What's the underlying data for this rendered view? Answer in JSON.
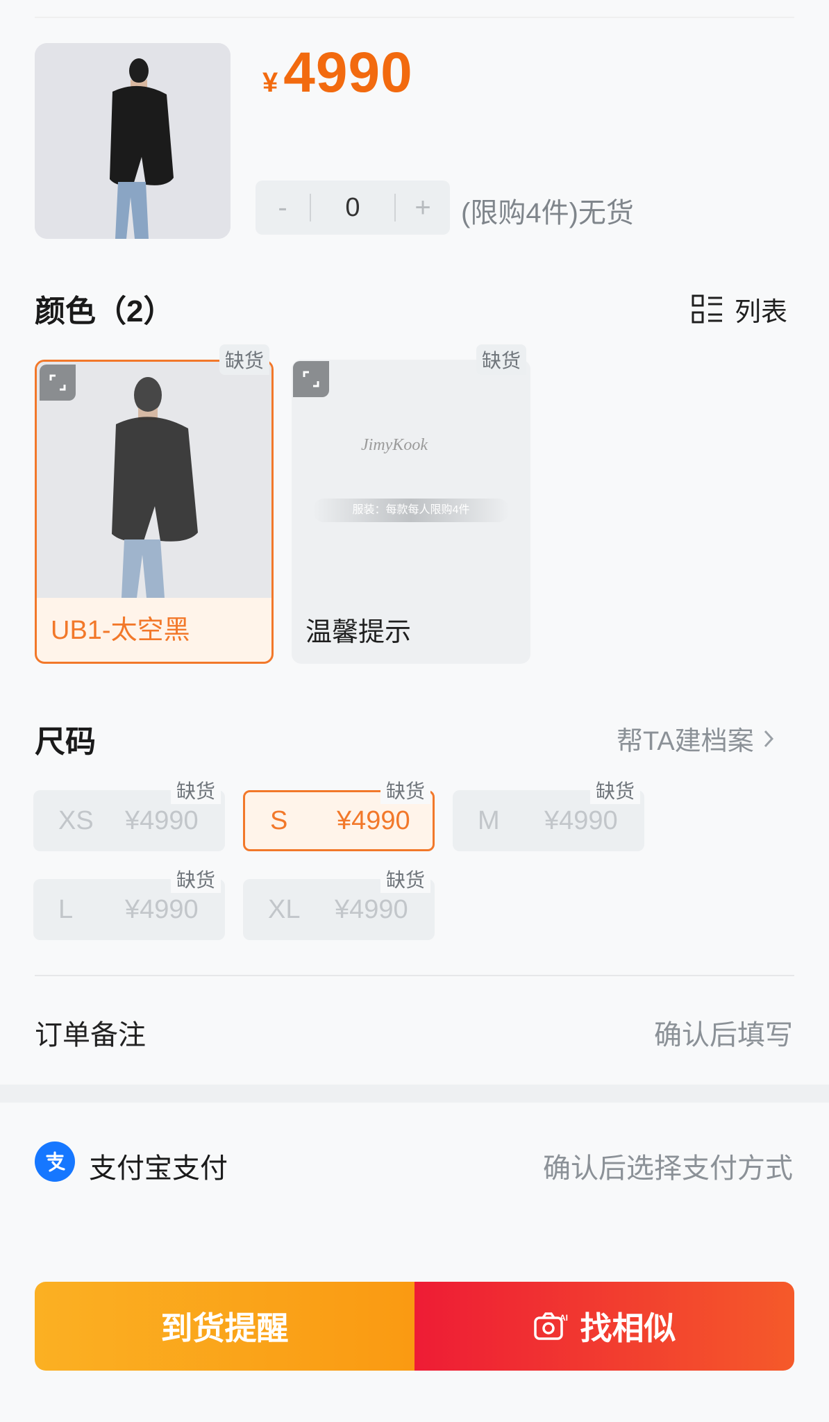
{
  "product": {
    "price_currency": "¥",
    "price_value": "4990",
    "quantity": "0",
    "minus_label": "-",
    "plus_label": "+",
    "limit_text": "(限购4件)无货"
  },
  "color_section": {
    "title": "颜色（2）",
    "list_label": "列表",
    "options": [
      {
        "label": "UB1-太空黑",
        "stock": "缺货"
      },
      {
        "label": "温馨提示",
        "stock": "缺货",
        "notice_brand": "JimyKook",
        "notice_text": "服装：每款每人限购4件"
      }
    ]
  },
  "size_section": {
    "title": "尺码",
    "archive_link": "帮TA建档案",
    "sizes": [
      {
        "size": "XS",
        "price": "¥4990",
        "stock": "缺货"
      },
      {
        "size": "S",
        "price": "¥4990",
        "stock": "缺货"
      },
      {
        "size": "M",
        "price": "¥4990",
        "stock": "缺货"
      },
      {
        "size": "L",
        "price": "¥4990",
        "stock": "缺货"
      },
      {
        "size": "XL",
        "price": "¥4990",
        "stock": "缺货"
      }
    ]
  },
  "remark": {
    "label": "订单备注",
    "value": "确认后填写"
  },
  "payment": {
    "label": "支付宝支付",
    "hint": "确认后选择支付方式"
  },
  "actions": {
    "notify_label": "到货提醒",
    "similar_label": "找相似"
  },
  "colors": {
    "accent": "#f26a0f",
    "alipay": "#1677ff",
    "danger": "#ee1c35"
  }
}
